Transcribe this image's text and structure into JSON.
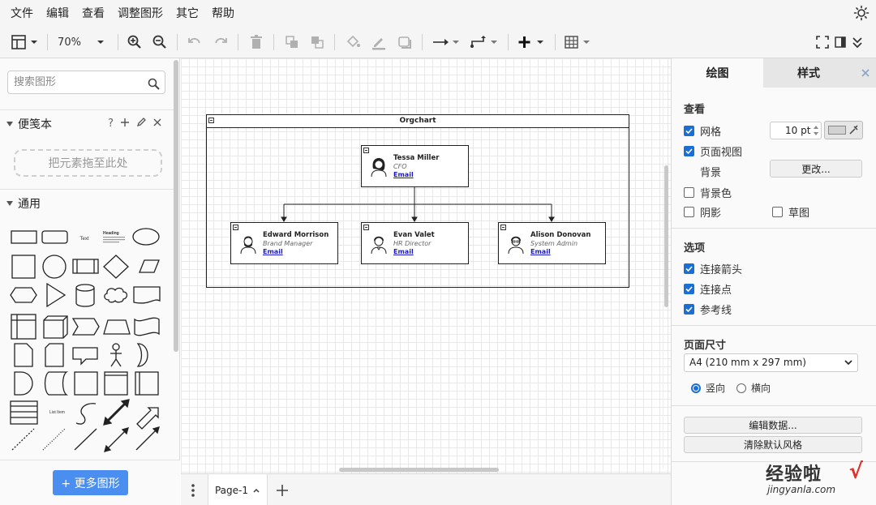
{
  "menu": [
    "文件",
    "编辑",
    "查看",
    "调整图形",
    "其它",
    "帮助"
  ],
  "toolbar": {
    "zoom": "70%"
  },
  "sidebar": {
    "search_placeholder": "搜索图形",
    "scratchpad_title": "便笺本",
    "scratchpad_help": "?",
    "dropzone": "把元素拖至此处",
    "general_title": "通用",
    "more_shapes": "+ 更多图形",
    "shape_text": "Text",
    "shape_heading": "Heading",
    "shape_list_item": "List Item"
  },
  "diagram": {
    "title": "Orgchart",
    "cfo": {
      "name": "Tessa Miller",
      "role": "CFO",
      "link": "Email"
    },
    "reports": [
      {
        "name": "Edward Morrison",
        "role": "Brand Manager",
        "link": "Email"
      },
      {
        "name": "Evan Valet",
        "role": "HR Director",
        "link": "Email"
      },
      {
        "name": "Alison Donovan",
        "role": "System Admin",
        "link": "Email"
      }
    ]
  },
  "pages": {
    "current": "Page-1"
  },
  "panel": {
    "tab_draw": "绘图",
    "tab_style": "样式",
    "view_title": "查看",
    "grid": "网格",
    "grid_size": "10 pt",
    "page_view": "页面视图",
    "background": "背景",
    "change": "更改...",
    "bg_color": "背景色",
    "shadow": "阴影",
    "sketch": "草图",
    "options_title": "选项",
    "connection_arrows": "连接箭头",
    "connection_points": "连接点",
    "guides": "参考线",
    "page_size_title": "页面尺寸",
    "page_size": "A4 (210 mm x 297 mm)",
    "portrait": "竖向",
    "landscape": "横向",
    "edit_data": "编辑数据...",
    "clear_style": "清除默认风格"
  },
  "watermark": {
    "text": "经验啦",
    "check": "√",
    "url": "jingyanla.com"
  }
}
